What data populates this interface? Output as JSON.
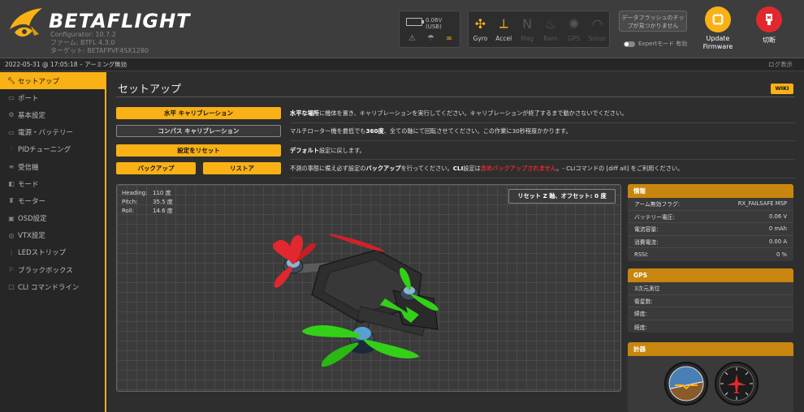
{
  "app": {
    "brand_beta": "BETA",
    "brand_flight": "FLIGHT",
    "configurator_version": "Configurator: 10.7.2",
    "firmware_version": "ファーム: BTFL 4.3.0",
    "target": "ターゲット: BETAFPVF4SX1280"
  },
  "connection": {
    "voltage": "0.06V (USB)"
  },
  "sensors": [
    {
      "name": "Gyro",
      "active": true
    },
    {
      "name": "Accel",
      "active": true
    },
    {
      "name": "Mag",
      "active": false
    },
    {
      "name": "Baro",
      "active": false
    },
    {
      "name": "GPS",
      "active": false
    },
    {
      "name": "Sonar",
      "active": false
    }
  ],
  "header": {
    "flash_chip_notice": "データフラッシュのチップが見つかりません",
    "expert_mode_label": "Expertモード 有効",
    "update_firmware_label_1": "Update",
    "update_firmware_label_2": "Firmware",
    "disconnect_label": "切断"
  },
  "status": {
    "datetime": "2022-05-31 @ 17:05:18",
    "arming": "アーミング無効",
    "log_button": "ログ表示"
  },
  "sidebar": {
    "items": [
      {
        "label": "セットアップ",
        "icon": "wrench-icon",
        "active": true
      },
      {
        "label": "ポート",
        "icon": "ports-icon",
        "active": false
      },
      {
        "label": "基本設定",
        "icon": "gear-icon",
        "active": false
      },
      {
        "label": "電源・バッテリー",
        "icon": "battery-icon",
        "active": false
      },
      {
        "label": "PIDチューニング",
        "icon": "pid-icon",
        "active": false
      },
      {
        "label": "受信機",
        "icon": "receiver-icon",
        "active": false
      },
      {
        "label": "モード",
        "icon": "modes-icon",
        "active": false
      },
      {
        "label": "モーター",
        "icon": "motor-icon",
        "active": false
      },
      {
        "label": "OSD設定",
        "icon": "osd-icon",
        "active": false
      },
      {
        "label": "VTX設定",
        "icon": "vtx-icon",
        "active": false
      },
      {
        "label": "LEDストリップ",
        "icon": "led-icon",
        "active": false
      },
      {
        "label": "ブラックボックス",
        "icon": "blackbox-icon",
        "active": false
      },
      {
        "label": "CLI コマンドライン",
        "icon": "cli-icon",
        "active": false
      }
    ]
  },
  "setup": {
    "title": "セットアップ",
    "wiki": "WIKI",
    "calibrate_accel": "水平 キャリブレーション",
    "calibrate_accel_desc_bold": "水平な場所",
    "calibrate_accel_desc": "に機体を置き、キャリブレーションを実行してください。キャリブレーションが終了するまで動かさないでください。",
    "calibrate_mag": "コンパス キャリブレーション",
    "calibrate_mag_desc_1": "マルチローター機を最低でも",
    "calibrate_mag_desc_bold": "360度",
    "calibrate_mag_desc_2": "、全ての軸にて回転させてください。この作業に30秒程度かかります。",
    "reset_settings": "設定をリセット",
    "reset_desc_bold": "デフォルト",
    "reset_desc": "設定に戻します。",
    "backup": "バックアップ",
    "restore": "リストア",
    "backup_desc_1": "不測の事態に備え必ず設定の",
    "backup_desc_bold1": "バックアップ",
    "backup_desc_2": "を行ってください。",
    "backup_desc_bold2": "CLI",
    "backup_desc_3": "設定は",
    "backup_desc_red": "含めバックアップされません",
    "backup_desc_4": "。- CLIコマンドの [diff all] をご利用ください。",
    "reset_z": "リセット Z 軸、オフセット: 0 度"
  },
  "attitude": {
    "heading_label": "Heading:",
    "heading_value": "110 度",
    "pitch_label": "Pitch:",
    "pitch_value": "35.5 度",
    "roll_label": "Roll:",
    "roll_value": "14.6 度"
  },
  "info_panel": {
    "title": "情報",
    "rows": [
      {
        "label": "アーム無効フラグ:",
        "value": "RX_FAILSAFE MSP"
      },
      {
        "label": "バッテリー電圧:",
        "value": "0.06 V"
      },
      {
        "label": "電流容量:",
        "value": "0 mAh"
      },
      {
        "label": "消費電流:",
        "value": "0.00 A"
      },
      {
        "label": "RSSI:",
        "value": "0 %"
      }
    ]
  },
  "gps_panel": {
    "title": "GPS",
    "rows": [
      {
        "label": "3次元測位",
        "value": ""
      },
      {
        "label": "衛星数:",
        "value": ""
      },
      {
        "label": "緯度:",
        "value": ""
      },
      {
        "label": "経度:",
        "value": ""
      }
    ]
  },
  "instruments_panel": {
    "title": "計器"
  },
  "colors": {
    "accent": "#f9b115",
    "panel_header": "#c8860f",
    "danger": "#e0282e"
  }
}
